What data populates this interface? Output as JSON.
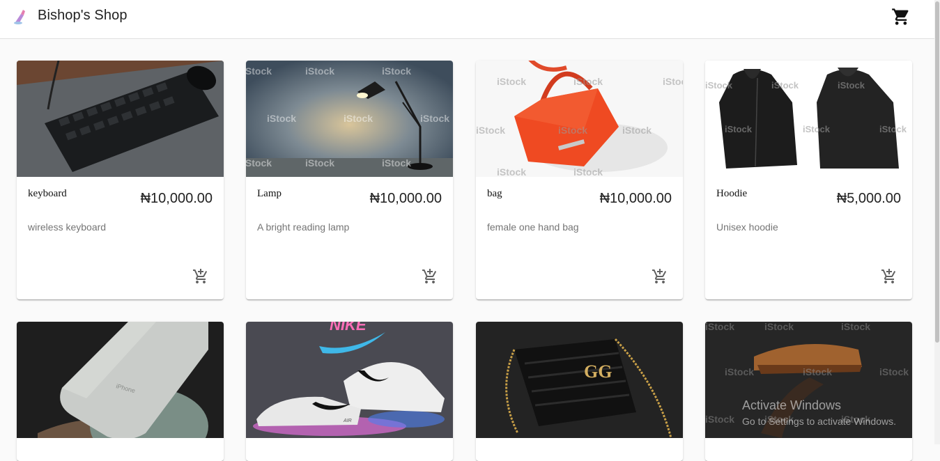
{
  "header": {
    "title": "Bishop's Shop",
    "logo_icon": "shop-logo-icon",
    "cart_icon": "shopping-cart-icon"
  },
  "products": [
    {
      "name": "keyboard",
      "price": "₦10,000.00",
      "description": "wireless keyboard",
      "add_icon": "add-shopping-cart-icon"
    },
    {
      "name": "Lamp",
      "price": "₦10,000.00",
      "description": "A bright reading lamp",
      "add_icon": "add-shopping-cart-icon"
    },
    {
      "name": "bag",
      "price": "₦10,000.00",
      "description": "female one hand bag",
      "add_icon": "add-shopping-cart-icon"
    },
    {
      "name": "Hoodie",
      "price": "₦5,000.00",
      "description": "Unisex hoodie",
      "add_icon": "add-shopping-cart-icon"
    }
  ],
  "image_text": {
    "istock": "iStock",
    "phone_label": "iPhone",
    "nike_logo": "NIKE",
    "nike_model": "AIR",
    "gucci_logo": "GG"
  },
  "watermark": {
    "title": "Activate Windows",
    "subtitle": "Go to Settings to activate Windows."
  },
  "colors": {
    "background": "#fafafa",
    "appbar": "#ffffff",
    "text_primary": "#212121",
    "text_secondary": "#757575"
  }
}
